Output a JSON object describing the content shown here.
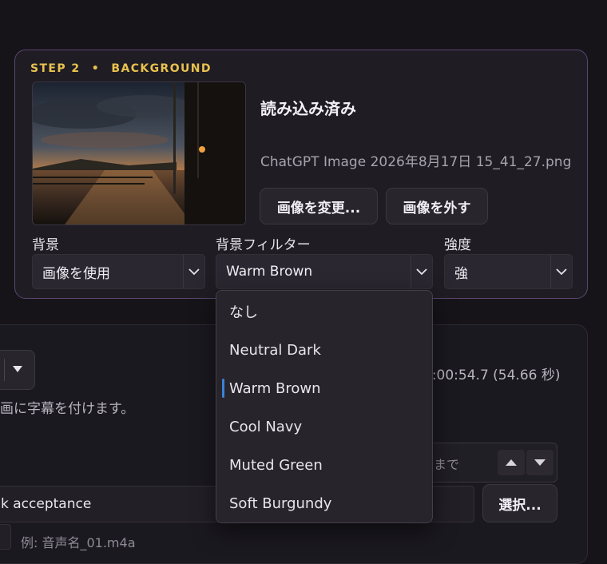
{
  "step": {
    "number": "STEP 2",
    "separator": "•",
    "name": "BACKGROUND"
  },
  "image_panel": {
    "status": "読み込み済み",
    "filename": "ChatGPT Image 2026年8月17日 15_41_27.png",
    "change_button": "画像を変更...",
    "remove_button": "画像を外す"
  },
  "fields": {
    "background": {
      "label": "背景",
      "value": "画像を使用"
    },
    "filter": {
      "label": "背景フィルター",
      "value": "Warm Brown"
    },
    "strength": {
      "label": "強度",
      "value": "強"
    }
  },
  "filter_options": [
    {
      "label": "なし",
      "selected": false
    },
    {
      "label": "Neutral Dark",
      "selected": false
    },
    {
      "label": "Warm Brown",
      "selected": true
    },
    {
      "label": "Cool Navy",
      "selected": false
    },
    {
      "label": "Muted Green",
      "selected": false
    },
    {
      "label": "Soft Burgundy",
      "selected": false
    }
  ],
  "lower_card": {
    "duration": "0:00:54.7 (54.66 秒)",
    "description": "画に字幕を付けます。",
    "range_suffix": "まで",
    "name_value": "k acceptance",
    "select_button": "選択...",
    "placeholder": "例: 音声名_01.m4a"
  },
  "icons": {
    "chevron": "chevron-down-icon",
    "triangle_up": "triangle-up-icon",
    "triangle_down": "triangle-down-icon"
  },
  "colors": {
    "accent_step": "#e9c24e",
    "card_border": "#5b4670",
    "selection_bar": "#3b82d6"
  }
}
